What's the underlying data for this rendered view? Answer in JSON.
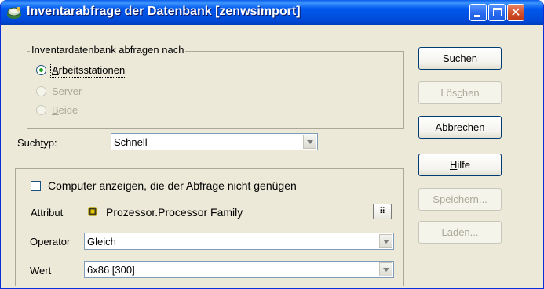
{
  "window": {
    "title": "Inventarabfrage der Datenbank [zenwsimport]"
  },
  "query_group": {
    "legend": "Inventardatenbank abfragen nach",
    "options": [
      {
        "prefix": "",
        "accel": "A",
        "rest": "rbeitsstationen",
        "checked": true,
        "enabled": true
      },
      {
        "prefix": "",
        "accel": "S",
        "rest": "erver",
        "checked": false,
        "enabled": false
      },
      {
        "prefix": "",
        "accel": "B",
        "rest": "eide",
        "checked": false,
        "enabled": false
      }
    ]
  },
  "search_type": {
    "label_pre": "Such",
    "label_accel": "t",
    "label_post": "yp:",
    "value": "Schnell"
  },
  "criteria": {
    "checkbox_label": "Computer anzeigen, die der Abfrage nicht genügen",
    "checkbox_checked": false,
    "attribute_label": "Attribut",
    "attribute_value": "Prozessor.Processor Family",
    "browse_glyph": "⠿",
    "operator_label": "Operator",
    "operator_value": "Gleich",
    "value_label": "Wert",
    "value_value": "6x86 [300]"
  },
  "buttons": {
    "search": {
      "pre": "S",
      "accel": "u",
      "post": "chen"
    },
    "clear": {
      "pre": "Lös",
      "accel": "c",
      "post": "hen"
    },
    "cancel": {
      "pre": "Abb",
      "accel": "r",
      "post": "echen"
    },
    "help": {
      "pre": "",
      "accel": "H",
      "post": "ilfe"
    },
    "save": {
      "pre": "",
      "accel": "S",
      "post": "peichern..."
    },
    "load": {
      "pre": "",
      "accel": "L",
      "post": "aden..."
    }
  },
  "colors": {
    "titlebar": "#0054e3",
    "dialog_bg": "#ece9d8",
    "disabled_text": "#aca899",
    "close_button": "#d2512c"
  },
  "icons": [
    "app-icon",
    "minimize-icon",
    "maximize-icon",
    "close-icon",
    "processor-icon",
    "browse-icon",
    "dropdown-arrow-icon"
  ]
}
